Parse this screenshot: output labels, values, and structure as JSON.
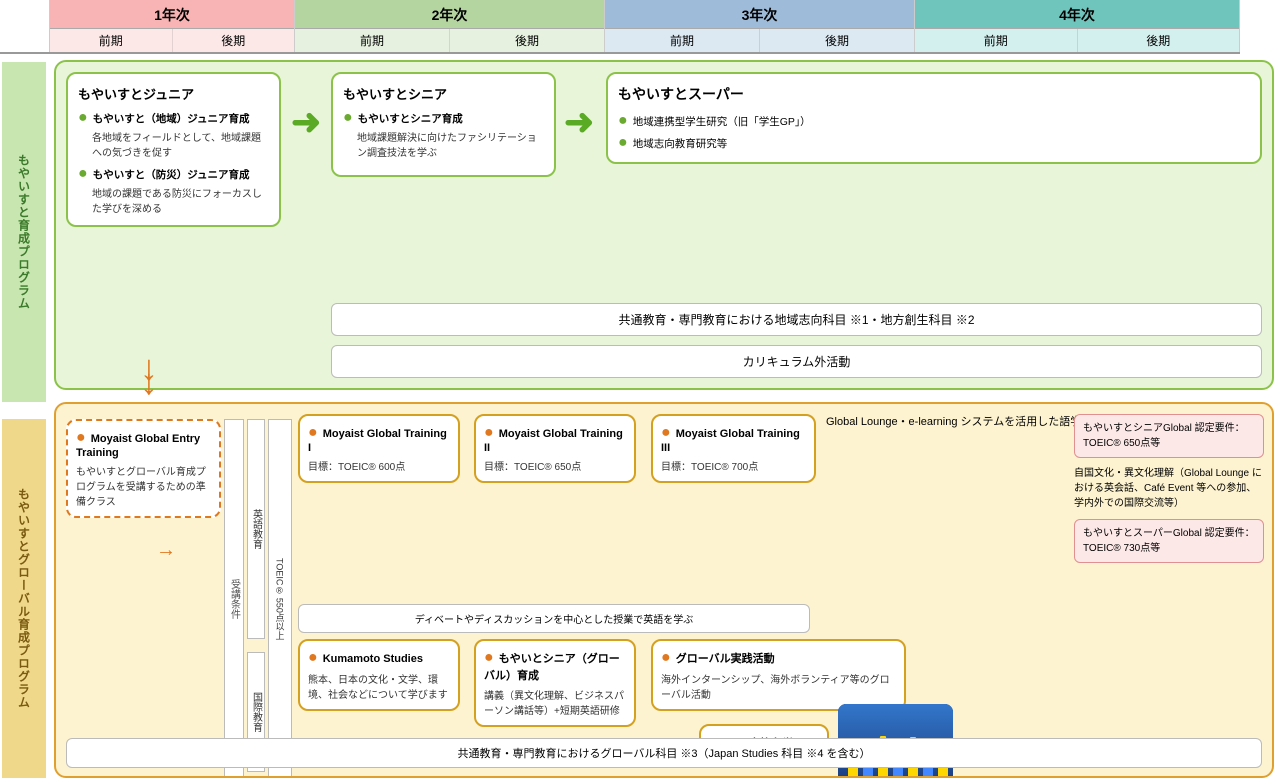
{
  "header": {
    "spacer": "",
    "year1": {
      "title": "1年次",
      "first": "前期",
      "second": "後期"
    },
    "year2": {
      "title": "2年次",
      "first": "前期",
      "second": "後期"
    },
    "year3": {
      "title": "3年次",
      "first": "前期",
      "second": "後期"
    },
    "year4": {
      "title": "4年次",
      "first": "前期",
      "second": "後期"
    }
  },
  "sidebar_top": "もやいすと育成プログラム",
  "sidebar_bottom": "もやいすとグローバル育成プログラム",
  "top_section": {
    "junior_card": {
      "title": "もやいすとジュニア",
      "bullet1_title": "もやいすと（地域）ジュニア育成",
      "bullet1_desc": "各地域をフィールドとして、地域課題への気づきを促す",
      "bullet2_title": "もやいすと（防災）ジュニア育成",
      "bullet2_desc": "地域の課題である防災にフォーカスした学びを深める"
    },
    "senior_card": {
      "title": "もやいすとシニア",
      "bullet1_title": "もやいすとシニア育成",
      "bullet1_desc": "地域課題解決に向けたファシリテーション調査技法を学ぶ"
    },
    "super_card": {
      "title": "もやいすとスーパー",
      "bullet1": "地域連携型学生研究（旧「学生GP」）",
      "bullet2": "地域志向教育研究等"
    },
    "kyotsu_bar": "共通教育・専門教育における地域志向科目 ※1・地方創生科目 ※2",
    "curriculum_bar": "カリキュラム外活動"
  },
  "bottom_section": {
    "entry_card": {
      "title": "Moyaist Global Entry Training",
      "desc": "もやいすとグローバル育成プログラムを受講するための準備クラス"
    },
    "juken": "受講条件",
    "eigo": "英語教育",
    "kokusai": "国際教育",
    "toeic": "TOEIC® 550点以上",
    "training1": {
      "title": "Moyaist Global Training I",
      "target": "目標：TOEIC® 600点"
    },
    "training2": {
      "title": "Moyaist Global Training II",
      "target": "目標：TOEIC® 650点"
    },
    "training3": {
      "title": "Moyaist Global Training III",
      "target": "目標：TOEIC® 700点"
    },
    "debate_bar": "ディベートやディスカッションを中心とした授業で英語を学ぶ",
    "kumamoto_card": {
      "title": "Kumamoto Studies",
      "desc": "熊本、日本の文化・文学、環境、社会などについて学びます"
    },
    "moyaist_global_card": {
      "title": "もやいとシニア（グローバル）育成",
      "desc": "講義（異文化理解、ビジネスパーソン講話等）+短期英語研修"
    },
    "global_jissen": {
      "title": "グローバル実践活動",
      "desc": "海外インターンシップ、海外ボランティア等のグローバル活動"
    },
    "koryu": {
      "title": "交換留学"
    },
    "global_lounge": "Global Lounge・e-learning システムを活用した語学力向上",
    "note1": "もやいすとシニアGlobal 認定要件：TOEIC® 650点等",
    "note_self": "自国文化・異文化理解（Global Lounge における英会話、Café Event 等への参加、学内外での国際交流等）",
    "note2": "もやいすとスーパーGlobal 認定要件：TOEIC® 730点等",
    "global_bar": "共通教育・専門教育におけるグローバル科目 ※3（Japan Studies 科目 ※4 を含む）"
  }
}
